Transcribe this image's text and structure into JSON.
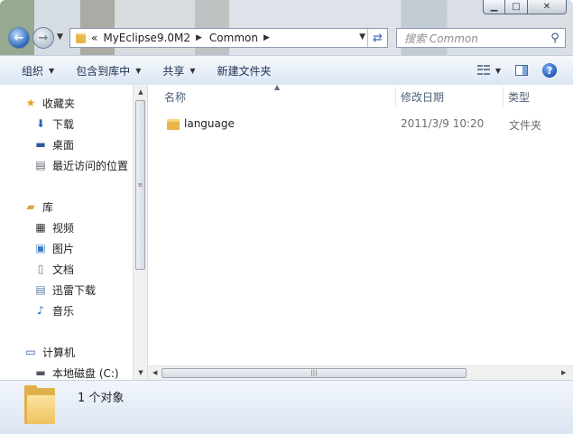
{
  "window": {
    "caption": {
      "minimize": "▁",
      "maximize": "□",
      "close": "✕"
    }
  },
  "nav": {
    "back_icon": "back-arrow-icon",
    "forward_icon": "forward-arrow-icon",
    "address": {
      "chevron": "«",
      "parts": [
        "MyEclipse9.0M2",
        "Common"
      ]
    },
    "search_placeholder": "搜索 Common"
  },
  "toolbar": {
    "items": [
      "组织",
      "包含到库中",
      "共享",
      "新建文件夹"
    ]
  },
  "sidebar": {
    "favorites": {
      "label": "收藏夹",
      "items": [
        "下载",
        "桌面",
        "最近访问的位置"
      ]
    },
    "libraries": {
      "label": "库",
      "items": [
        "视频",
        "图片",
        "文档",
        "迅雷下载",
        "音乐"
      ]
    },
    "computer": {
      "label": "计算机",
      "items": [
        "本地磁盘 (C:)"
      ]
    }
  },
  "filelist": {
    "columns": [
      "名称",
      "修改日期",
      "类型"
    ],
    "rows": [
      {
        "name": "language",
        "modified": "2011/3/9 10:20",
        "type": "文件夹"
      }
    ]
  },
  "details": {
    "count_text": "1 个对象"
  },
  "colors": {
    "accent": "#2a66b8",
    "folder": "#e7b54a"
  }
}
